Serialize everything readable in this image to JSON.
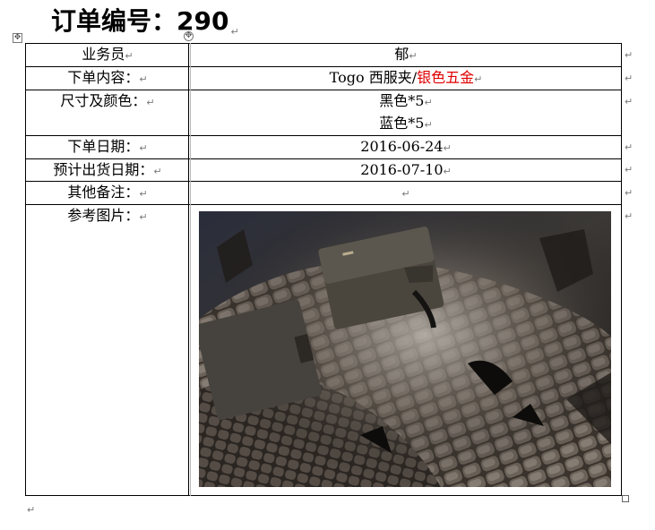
{
  "order": {
    "title": "订单编号：290",
    "fields": [
      {
        "label": "业务员",
        "value": "郁"
      },
      {
        "label": "下单内容：",
        "value_main": "Togo 西服夹/",
        "value_highlight": "银色五金",
        "highlight_color": "#e00000"
      },
      {
        "label": "尺寸及颜色：",
        "value_line1": "黑色*5",
        "value_line2": "蓝色*5"
      },
      {
        "label": "下单日期：",
        "value": "2016-06-24"
      },
      {
        "label": "预计出货日期：",
        "value": "2016-07-10"
      },
      {
        "label": "其他备注：",
        "value": ""
      },
      {
        "label": "参考图片："
      }
    ]
  },
  "editor_marks": {
    "paragraph_mark": "↵",
    "table_move_handle": "✥"
  },
  "reference_image": {
    "description_icon": "photo-leather-wallets-on-crocodile-skin"
  }
}
